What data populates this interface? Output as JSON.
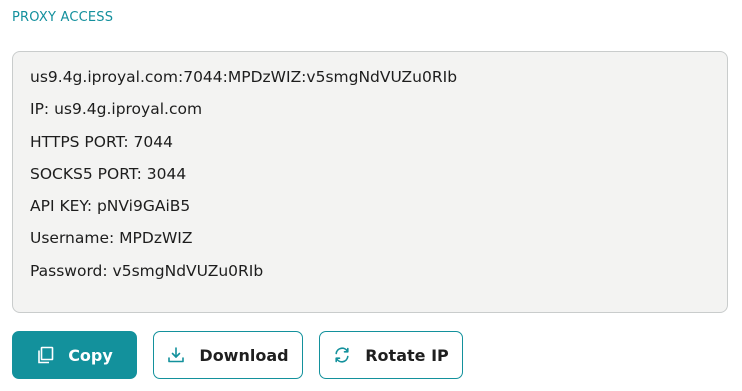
{
  "section": {
    "title": "PROXY ACCESS"
  },
  "credentials": {
    "full_string": "us9.4g.iproyal.com:7044:MPDzWIZ:v5smgNdVUZu0RIb",
    "ip": "IP: us9.4g.iproyal.com",
    "https_port": "HTTPS PORT: 7044",
    "socks5_port": "SOCKS5 PORT: 3044",
    "api_key": "API KEY: pNVi9GAiB5",
    "username": "Username: MPDzWIZ",
    "password": "Password: v5smgNdVUZu0RIb"
  },
  "actions": {
    "copy": {
      "label": "Copy",
      "icon": "copy-icon"
    },
    "download": {
      "label": "Download",
      "icon": "download-icon"
    },
    "rotate": {
      "label": "Rotate IP",
      "icon": "rotate-icon"
    }
  },
  "colors": {
    "accent": "#13919c",
    "box_background": "#f3f3f2",
    "text": "#1d1d1d"
  }
}
